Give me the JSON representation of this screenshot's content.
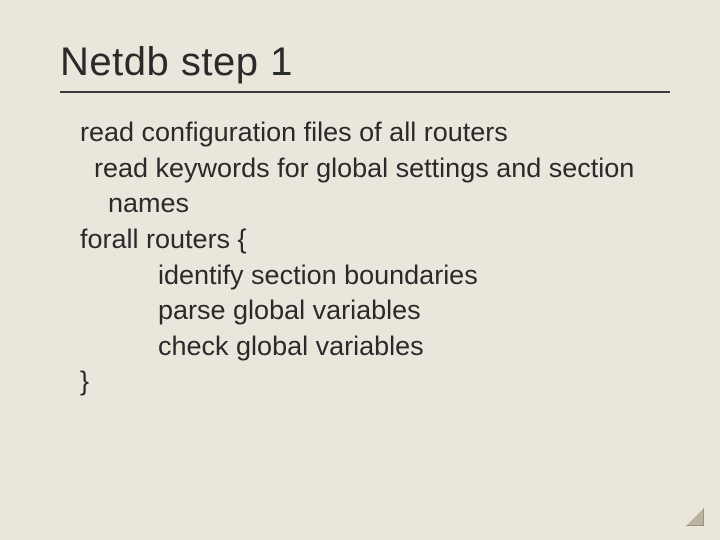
{
  "title": "Netdb step 1",
  "body": {
    "line1": "read configuration files of all routers",
    "line2": "read keywords for global settings and section names",
    "line3": "forall routers {",
    "line4": "identify section boundaries",
    "line5": "parse global variables",
    "line6": "check global variables",
    "line7": "}"
  }
}
